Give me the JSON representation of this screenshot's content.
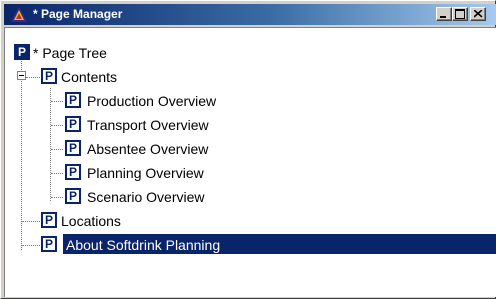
{
  "window": {
    "title": "* Page Manager"
  },
  "tree": {
    "root": {
      "label": "* Page Tree",
      "icon": "page-icon"
    },
    "contents": {
      "label": "Contents",
      "icon": "page-icon",
      "expanded": true,
      "children": [
        {
          "label": "Production Overview",
          "icon": "page-icon"
        },
        {
          "label": "Transport Overview",
          "icon": "page-icon"
        },
        {
          "label": "Absentee Overview",
          "icon": "page-icon"
        },
        {
          "label": "Planning Overview",
          "icon": "page-icon"
        },
        {
          "label": "Scenario Overview",
          "icon": "page-icon"
        }
      ]
    },
    "locations": {
      "label": "Locations",
      "icon": "page-icon"
    },
    "about": {
      "label": "About Softdrink Planning",
      "icon": "page-icon",
      "selected": true
    }
  },
  "icon_glyph": "P",
  "colors": {
    "titlebar_start": "#0a246a",
    "titlebar_end": "#a6caf0",
    "selection": "#0a246a",
    "icon_blue": "#0a246a"
  }
}
